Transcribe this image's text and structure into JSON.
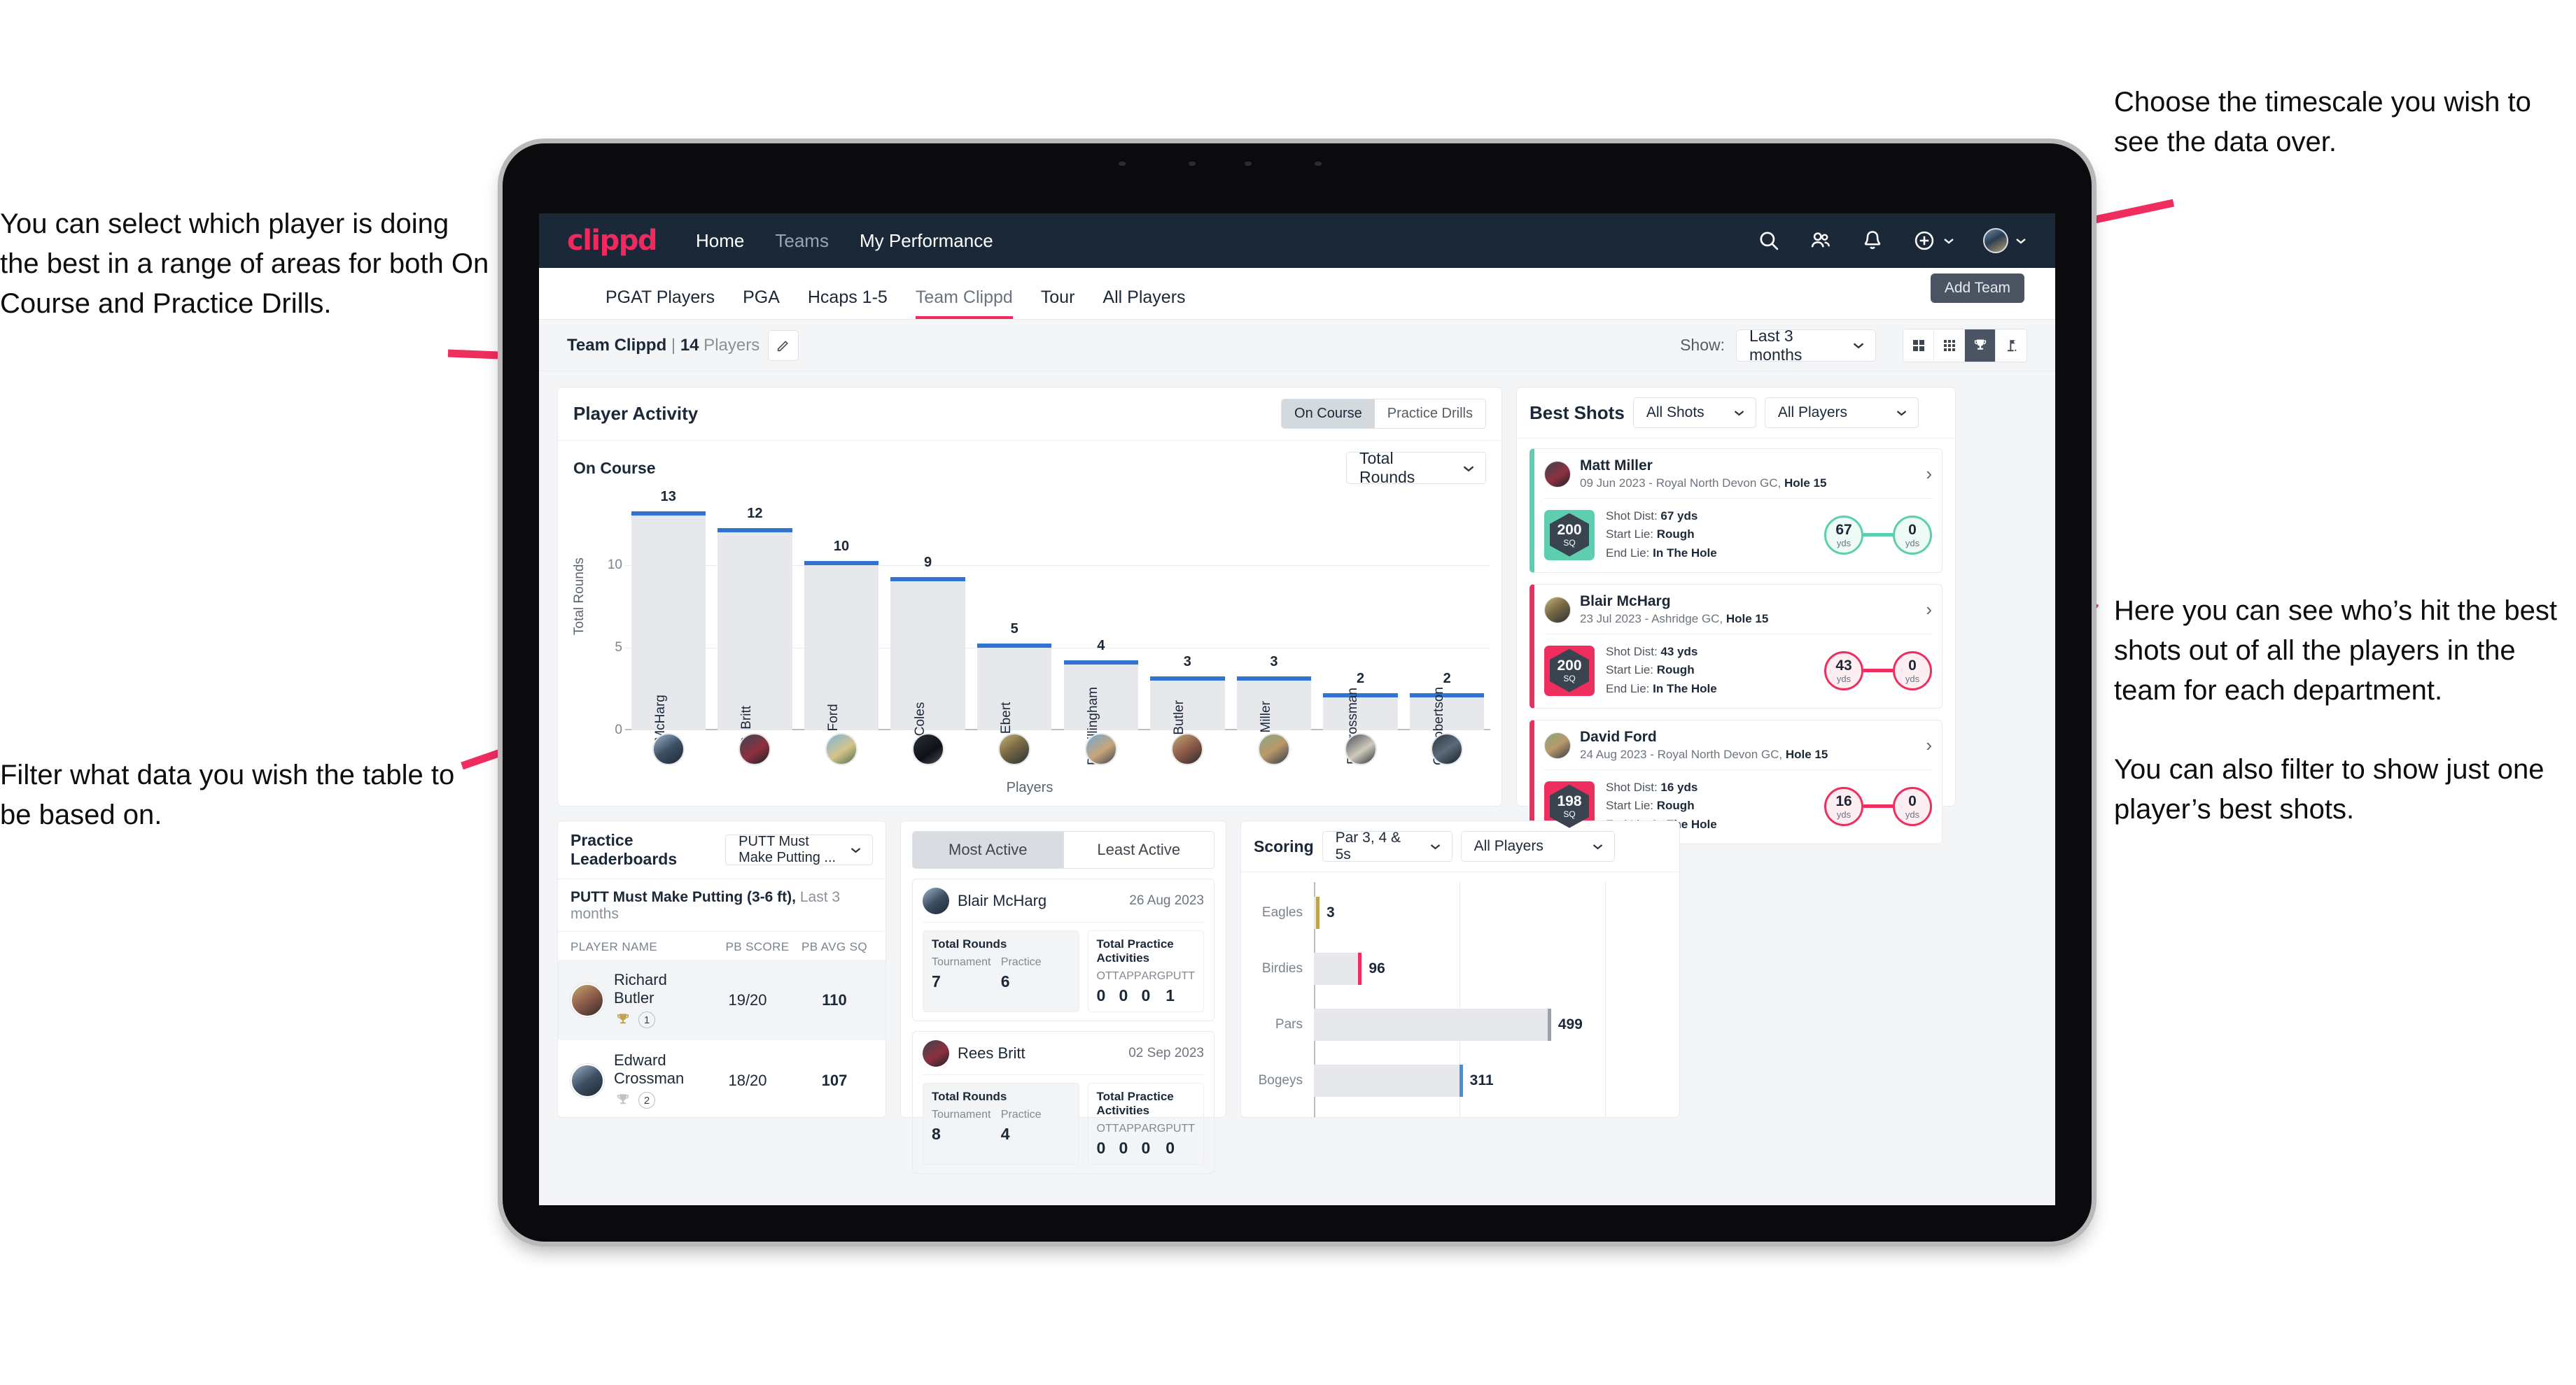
{
  "annotations": {
    "left_top": "You can select which player is doing the best in a range of areas for both On Course and Practice Drills.",
    "left_bottom": "Filter what data you wish the table to be based on.",
    "right_top": "Choose the timescale you wish to see the data over.",
    "right_mid_p1": "Here you can see who’s hit the best shots out of all the players in the team for each department.",
    "right_mid_p2": "You can also filter to show just one player’s best shots."
  },
  "appbar": {
    "logo": "clippd",
    "links": [
      {
        "label": "Home",
        "dim": false
      },
      {
        "label": "Teams",
        "dim": true
      },
      {
        "label": "My Performance",
        "dim": false
      }
    ],
    "icons": [
      "search-icon",
      "people-icon",
      "bell-icon",
      "plus-circle-icon",
      "avatar-icon"
    ]
  },
  "tabs": {
    "items": [
      {
        "label": "PGAT Players",
        "active": false
      },
      {
        "label": "PGA",
        "active": false
      },
      {
        "label": "Hcaps 1-5",
        "active": false
      },
      {
        "label": "Team Clippd",
        "active": true
      },
      {
        "label": "Tour",
        "active": false
      },
      {
        "label": "All Players",
        "active": false
      }
    ],
    "tooltip": "Add Team"
  },
  "toolbar": {
    "team_name": "Team Clippd",
    "team_sep": " | ",
    "team_count": "14",
    "team_players_word": " Players",
    "edit_icon": "pencil-icon",
    "show_label": "Show:",
    "show_value": "Last 3 months",
    "view_icons": [
      "grid-large-icon",
      "grid-small-icon",
      "trophy-icon",
      "flag-icon"
    ],
    "view_active_index": 2
  },
  "player_activity": {
    "title": "Player Activity",
    "segments": [
      {
        "label": "On Course",
        "active": true
      },
      {
        "label": "Practice Drills",
        "active": false
      }
    ],
    "sub_label": "On Course",
    "metric_select": "Total Rounds"
  },
  "best_shots": {
    "title": "Best Shots",
    "filter_shots": "All Shots",
    "filter_players": "All Players",
    "cards": [
      {
        "name": "Matt Miller",
        "meta_prefix": "09 Jun 2023 - Royal North Devon GC, ",
        "meta_hole": "Hole 15",
        "badge_value": "200",
        "badge_unit": "SQ",
        "accent": "#5ecfae",
        "shot_dist_label": "Shot Dist: ",
        "shot_dist": "67 yds",
        "start_lie_label": "Start Lie: ",
        "start_lie": "Rough",
        "end_lie_label": "End Lie: ",
        "end_lie": "In The Hole",
        "from_value": "67",
        "from_unit": "yds",
        "to_value": "0",
        "to_unit": "yds"
      },
      {
        "name": "Blair McHarg",
        "meta_prefix": "23 Jul 2023 - Ashridge GC, ",
        "meta_hole": "Hole 15",
        "badge_value": "200",
        "badge_unit": "SQ",
        "accent": "#ef2d5e",
        "shot_dist_label": "Shot Dist: ",
        "shot_dist": "43 yds",
        "start_lie_label": "Start Lie: ",
        "start_lie": "Rough",
        "end_lie_label": "End Lie: ",
        "end_lie": "In The Hole",
        "from_value": "43",
        "from_unit": "yds",
        "to_value": "0",
        "to_unit": "yds"
      },
      {
        "name": "David Ford",
        "meta_prefix": "24 Aug 2023 - Royal North Devon GC, ",
        "meta_hole": "Hole 15",
        "badge_value": "198",
        "badge_unit": "SQ",
        "accent": "#ef2d5e",
        "shot_dist_label": "Shot Dist: ",
        "shot_dist": "16 yds",
        "start_lie_label": "Start Lie: ",
        "start_lie": "Rough",
        "end_lie_label": "End Lie: ",
        "end_lie": "In The Hole",
        "from_value": "16",
        "from_unit": "yds",
        "to_value": "0",
        "to_unit": "yds"
      }
    ]
  },
  "practice_leaderboards": {
    "title": "Practice Leaderboards",
    "drill_select": "PUTT Must Make Putting ...",
    "sub_bold": "PUTT Must Make Putting (3-6 ft),",
    "sub_light": " Last 3 months",
    "columns": [
      "PLAYER NAME",
      "PB SCORE",
      "PB AVG SQ"
    ],
    "rows": [
      {
        "name": "Richard Butler",
        "rank": "1",
        "trophy_color": "#c0a34f",
        "pb_score": "19/20",
        "pb_avg_sq": "110"
      },
      {
        "name": "Edward Crossman",
        "rank": "2",
        "trophy_color": "#bfc3c8",
        "pb_score": "18/20",
        "pb_avg_sq": "107"
      }
    ]
  },
  "activity": {
    "tabs": [
      {
        "label": "Most Active",
        "active": true
      },
      {
        "label": "Least Active",
        "active": false
      }
    ],
    "rounds_title": "Total Rounds",
    "rounds_cols": [
      "Tournament",
      "Practice"
    ],
    "practice_title": "Total Practice Activities",
    "practice_cols": [
      "OTT",
      "APP",
      "ARG",
      "PUTT"
    ],
    "cards": [
      {
        "name": "Blair McHarg",
        "date": "26 Aug 2023",
        "rounds": [
          "7",
          "6"
        ],
        "practice": [
          "0",
          "0",
          "0",
          "1"
        ]
      },
      {
        "name": "Rees Britt",
        "date": "02 Sep 2023",
        "rounds": [
          "8",
          "4"
        ],
        "practice": [
          "0",
          "0",
          "0",
          "0"
        ]
      }
    ]
  },
  "scoring": {
    "title": "Scoring",
    "filter_par": "Par 3, 4 & 5s",
    "filter_players": "All Players"
  },
  "chart_data": [
    {
      "type": "bar",
      "title": "Player Activity - On Course",
      "xlabel": "Players",
      "ylabel": "Total Rounds",
      "ylim": [
        0,
        13.8
      ],
      "yticks": [
        0,
        5,
        10
      ],
      "grid": true,
      "categories": [
        "B. McHarg",
        "R. Britt",
        "D. Ford",
        "J. Coles",
        "E. Ebert",
        "D. Billingham",
        "R. Butler",
        "M. Miller",
        "E. Crossman",
        "C. Robertson"
      ],
      "values": [
        13,
        12,
        10,
        9,
        5,
        4,
        3,
        3,
        2,
        2
      ],
      "bar_color": "#e6e8ec",
      "cap_color": "#2f74d0"
    },
    {
      "type": "bar",
      "orientation": "horizontal",
      "title": "Scoring",
      "categories": [
        "Eagles",
        "Birdies",
        "Pars",
        "Bogeys"
      ],
      "values": [
        3,
        96,
        499,
        311
      ],
      "xlim": [
        0,
        620
      ],
      "grid": true,
      "bar_color": "#e6e8ec",
      "cap_colors": [
        "#c0a34f",
        "#ef2d5e",
        "#9ba1a8",
        "#4a90d9"
      ]
    }
  ]
}
